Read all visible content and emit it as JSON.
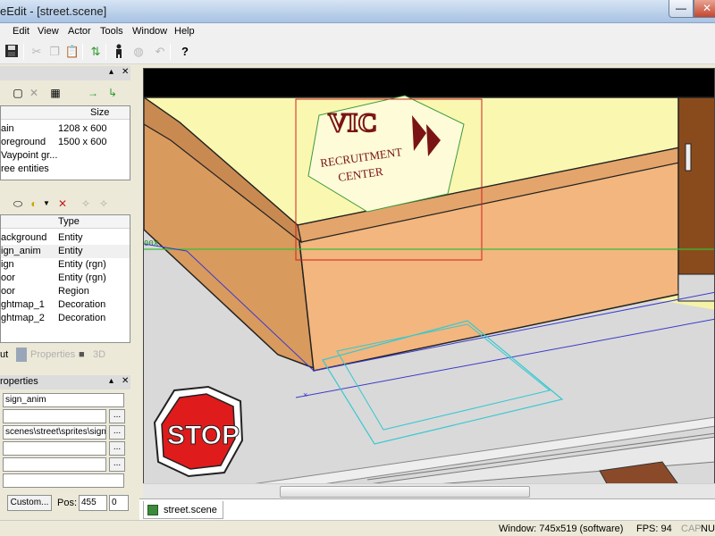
{
  "window": {
    "title": "eEdit - [street.scene]",
    "min_glyph": "—",
    "close_glyph": "✕"
  },
  "menu": [
    "Edit",
    "View",
    "Actor",
    "Tools",
    "Window",
    "Help"
  ],
  "toolbar": {
    "icons": [
      "save-icon",
      "cut-icon",
      "copy-icon",
      "paste-icon",
      "refresh-icon",
      "actor-icon",
      "globe-icon",
      "undo-icon",
      "help-icon"
    ]
  },
  "layers_panel": {
    "header_col": "Size",
    "rows": [
      {
        "name": "ain",
        "size": "1208 x 600"
      },
      {
        "name": "oreground",
        "size": "1500 x 600"
      },
      {
        "name": "Vaypoint gr...",
        "size": ""
      },
      {
        "name": "ree entities",
        "size": ""
      }
    ]
  },
  "entities_panel": {
    "header_col": "Type",
    "rows": [
      {
        "name": "ackground",
        "type": "Entity"
      },
      {
        "name": "ign_anim",
        "type": "Entity"
      },
      {
        "name": "ign",
        "type": "Entity (rgn)"
      },
      {
        "name": "oor",
        "type": "Entity (rgn)"
      },
      {
        "name": "oor",
        "type": "Region"
      },
      {
        "name": "ghtmap_1",
        "type": "Decoration"
      },
      {
        "name": "ghtmap_2",
        "type": "Decoration"
      }
    ]
  },
  "tabs": {
    "layout": "ut",
    "properties": "Properties",
    "three_d": "3D"
  },
  "properties_panel": {
    "title": "roperties",
    "name_value": "sign_anim",
    "sprite_value": "scenes\\street\\sprites\\sign",
    "browse_label": "...",
    "custom_label": "Custom...",
    "pos_label": "Pos:",
    "pos_x": "455",
    "pos_y": "0"
  },
  "viewport": {
    "sign_line1": "RECRUITMENT",
    "sign_line2": "CENTER",
    "sign_logo": "VIC",
    "stop_text": "STOP",
    "marker_text": "00X"
  },
  "doc_tab": "street.scene",
  "status": {
    "window": "Window: 745x519 (software)",
    "fps": "FPS: 94",
    "cap": "CAP",
    "num": "NUM"
  }
}
